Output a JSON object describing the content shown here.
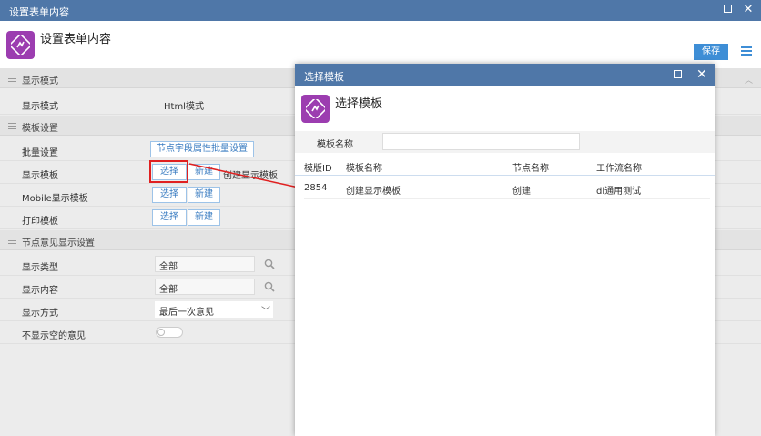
{
  "window": {
    "title": "设置表单内容",
    "page_title": "设置表单内容"
  },
  "toolbar": {
    "save_label": "保存"
  },
  "sections": {
    "display_mode": "显示模式",
    "template_settings": "模板设置",
    "node_opinion": "节点意见显示设置"
  },
  "rows": {
    "display_mode": {
      "label": "显示模式",
      "value": "Html模式"
    },
    "batch": {
      "label": "批量设置",
      "button": "节点字段属性批量设置"
    },
    "display_template": {
      "label": "显示模板",
      "select": "选择",
      "new": "新建",
      "value": "创建显示模板"
    },
    "mobile_template": {
      "label": "Mobile显示模板",
      "select": "选择",
      "new": "新建"
    },
    "print_template": {
      "label": "打印模板",
      "select": "选择",
      "new": "新建"
    },
    "display_type": {
      "label": "显示类型",
      "value": "全部"
    },
    "display_content": {
      "label": "显示内容",
      "value": "全部"
    },
    "display_method": {
      "label": "显示方式",
      "value": "最后一次意见"
    },
    "hide_empty": {
      "label": "不显示空的意见"
    }
  },
  "dialog": {
    "title": "选择模板",
    "page_title": "选择模板",
    "search_label": "模板名称",
    "search_value": "",
    "columns": [
      "模版ID",
      "模板名称",
      "节点名称",
      "工作流名称"
    ],
    "rows": [
      [
        "2854",
        "创建显示模板",
        "创建",
        "dl通用测试"
      ]
    ]
  },
  "colors": {
    "titlebar": "#4f77a8",
    "accent": "#3e8ed6",
    "highlight": "#e02020",
    "icon_bg": "#9c3db0"
  }
}
